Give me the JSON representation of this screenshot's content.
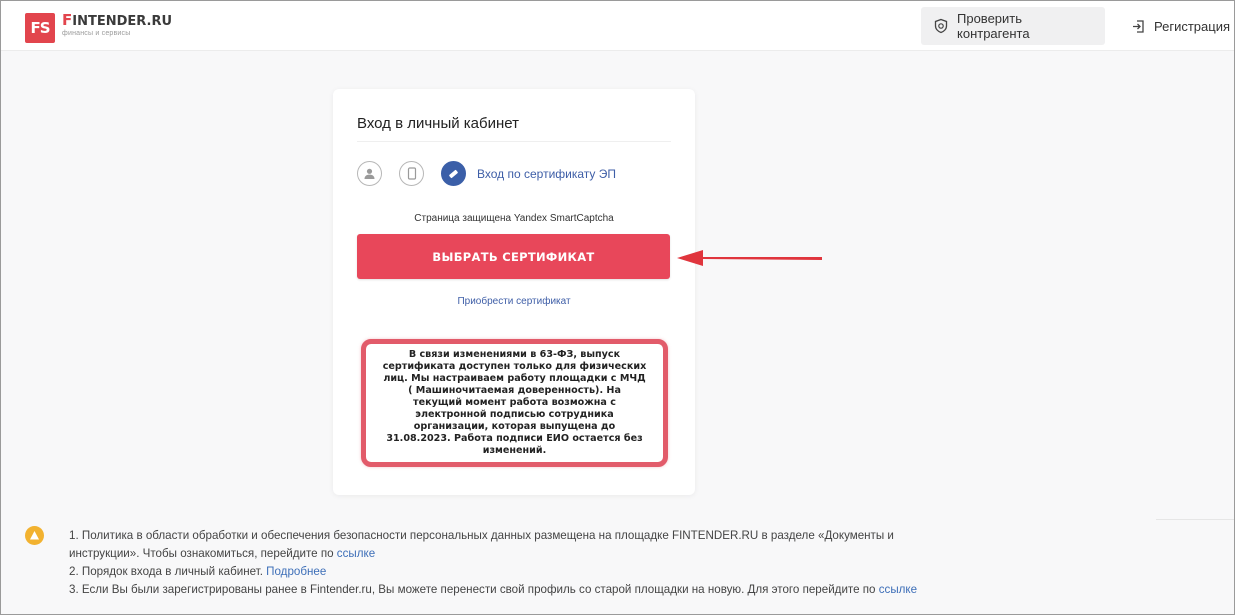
{
  "header": {
    "logo_mark": "FS",
    "logo_first_letter": "F",
    "logo_rest": "INTENDER.RU",
    "logo_subtitle": "финансы и сервисы",
    "check_label": "Проверить контрагента",
    "register_label": "Регистрация"
  },
  "login": {
    "title": "Вход в личный кабинет",
    "cert_tab_label": "Вход по сертификату ЭП",
    "captcha_notice": "Страница защищена Yandex SmartCaptcha",
    "select_cert_label": "ВЫБРАТЬ СЕРТИФИКАТ",
    "buy_cert_link": "Приобрести сертификат",
    "notice": "В связи изменениями в 63-ФЗ, выпуск сертификата доступен только для физических лиц. Мы настраиваем работу площадки с МЧД ( Машиночитаемая доверенность). На текущий момент работа возможна с электронной подписью сотрудника организации, которая выпущена до 31.08.2023. Работа подписи ЕИО остается без изменений."
  },
  "info": {
    "item1_line1": "1. Политика в области обработки и обеспечения безопасности персональных данных размещена на площадке FINTENDER.RU в разделе «Документы и",
    "item1_line2": "инструкции». Чтобы ознакомиться, перейдите по ",
    "item1_link": "ссылке",
    "item2_text": "2. Порядок входа в личный кабинет. ",
    "item2_link": "Подробнее",
    "item3_text": "3. Если Вы были зарегистрированы ранее в Fintender.ru, Вы можете перенести свой профиль со старой площадки на новую. Для этого перейдите по ",
    "item3_link": "ссылке"
  },
  "colors": {
    "brand_red": "#e2454d",
    "button_red": "#e8475a",
    "link_blue": "#3e5ea7",
    "warning_yellow": "#f2b230"
  },
  "icons": [
    "shield-icon",
    "login-icon",
    "user-icon",
    "phone-icon",
    "certificate-icon",
    "warning-icon",
    "arrow-icon"
  ]
}
